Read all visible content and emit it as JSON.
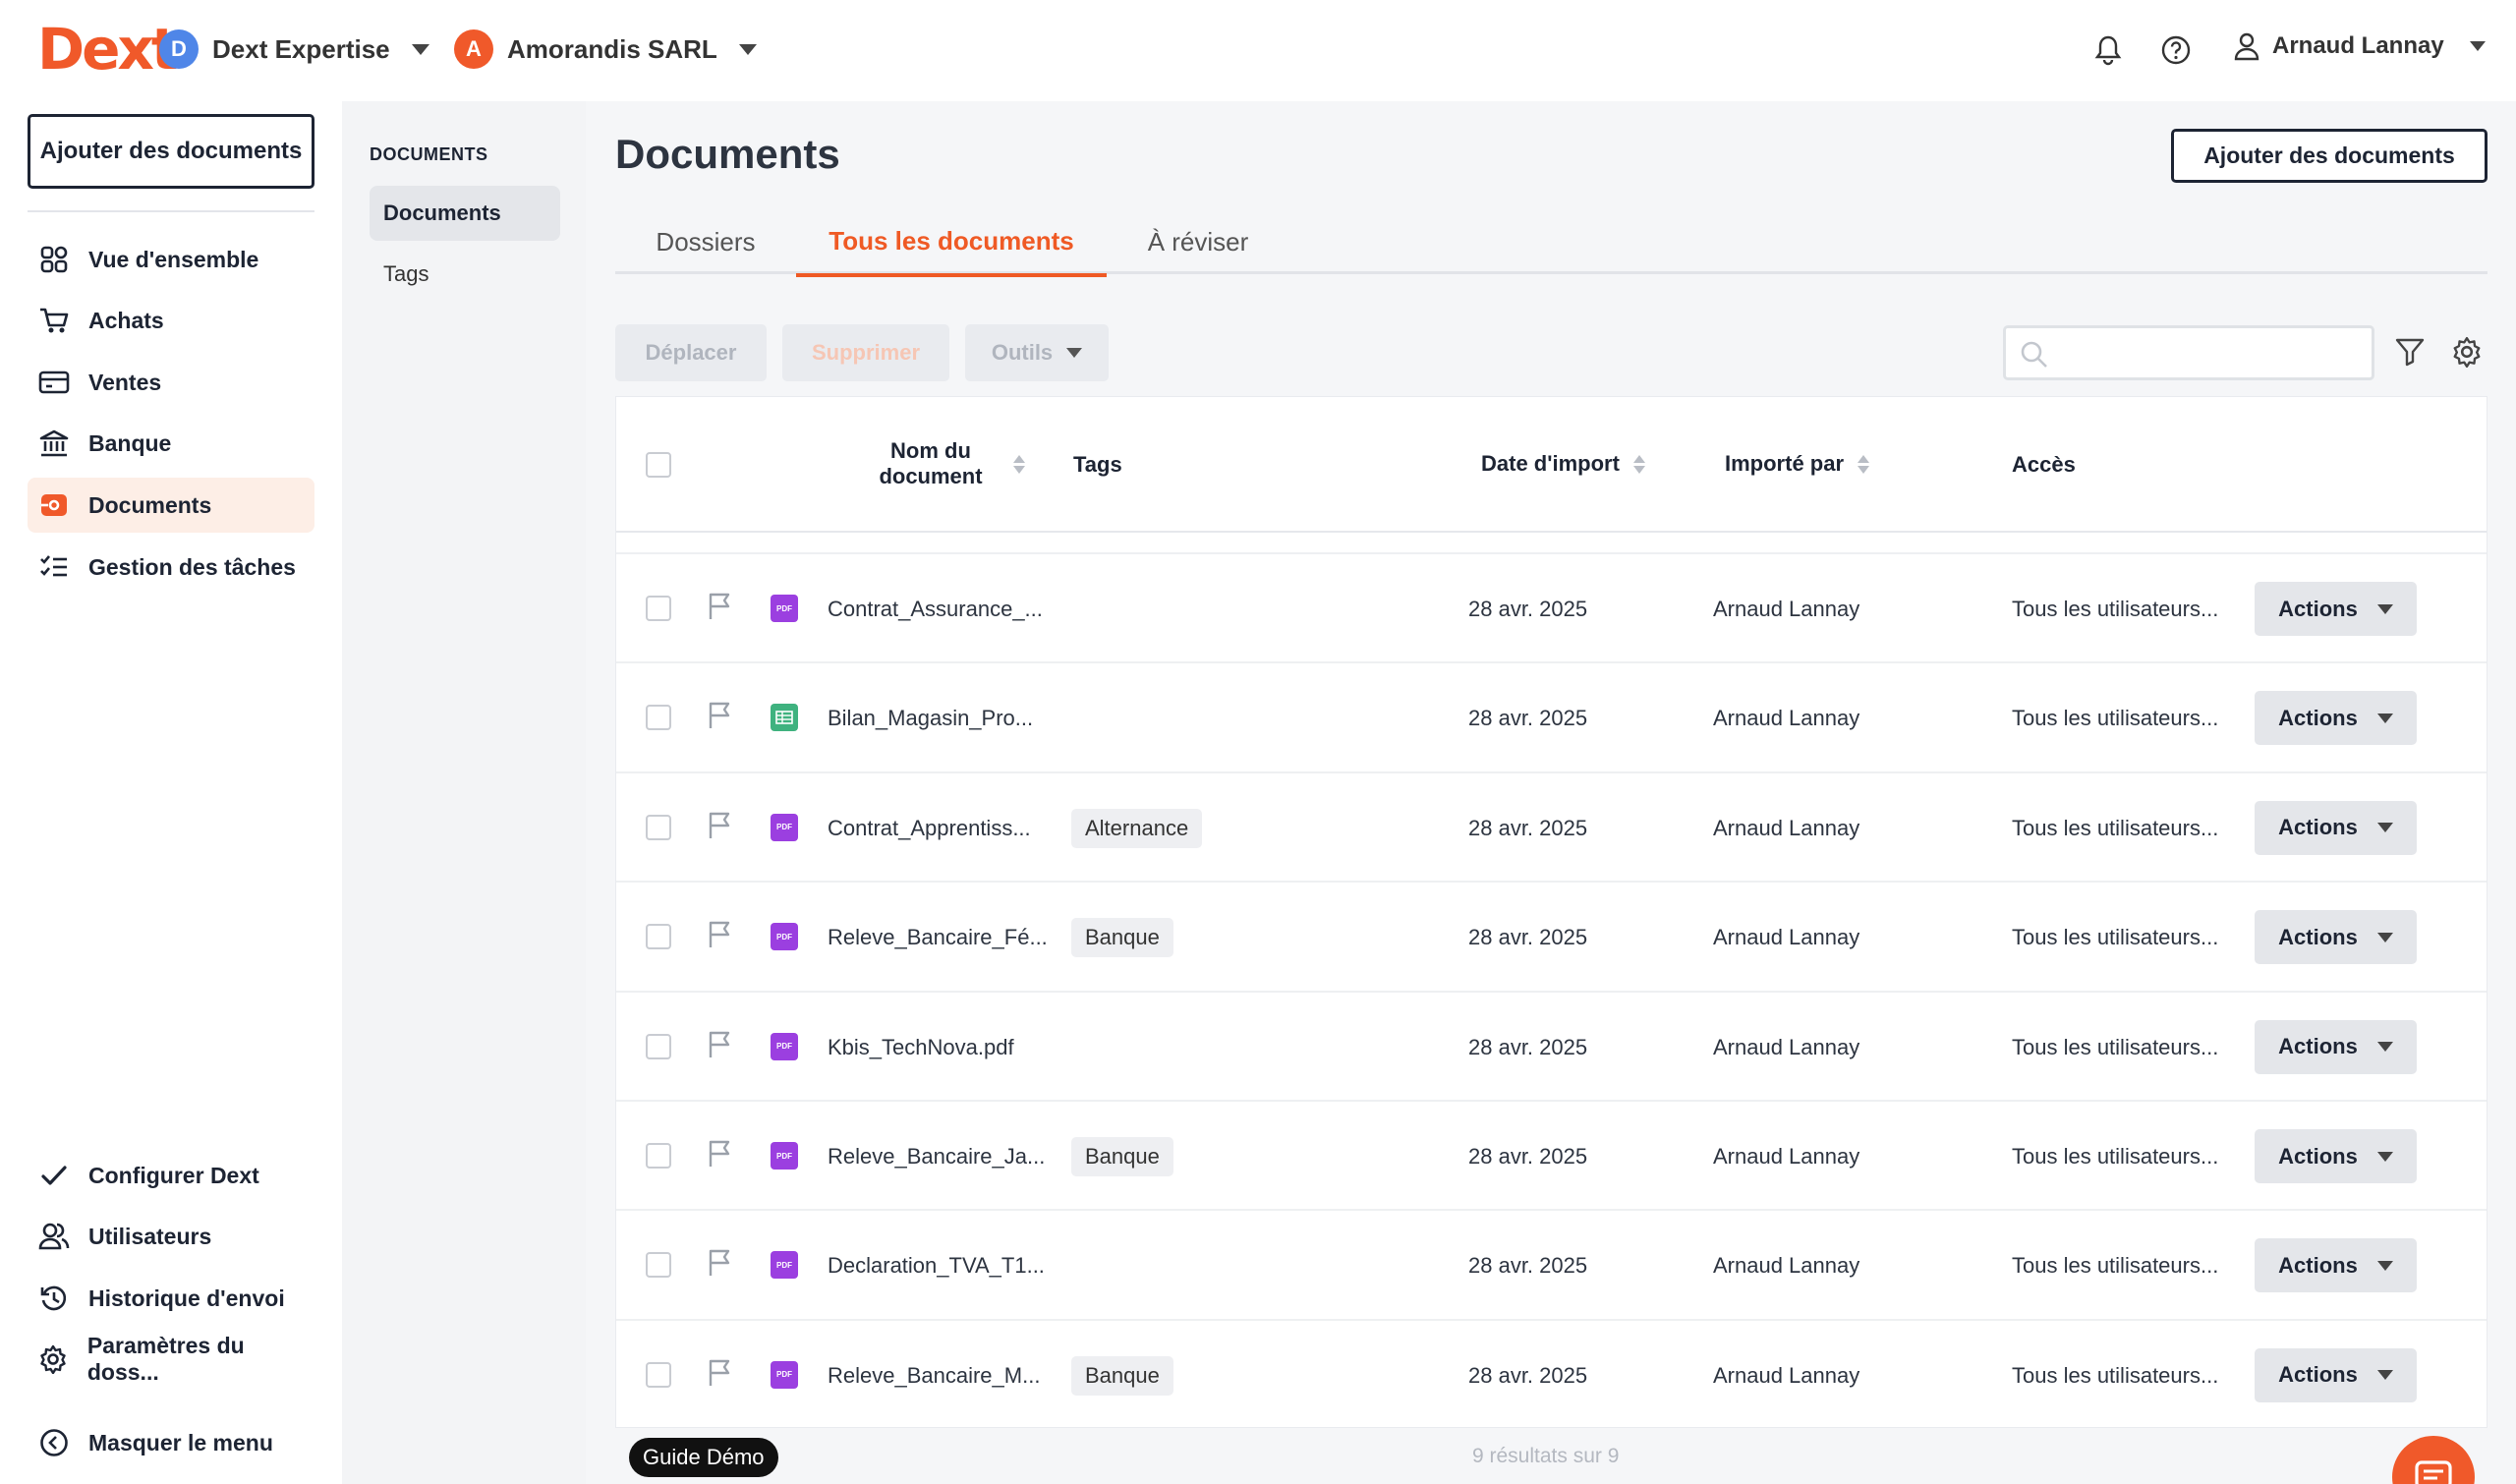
{
  "app": {
    "logo": "Dext"
  },
  "header": {
    "workspace": {
      "initial": "D",
      "name": "Dext Expertise",
      "color": "#4f86e8"
    },
    "client": {
      "initial": "A",
      "name": "Amorandis SARL",
      "color": "#f0592a"
    },
    "user": {
      "name": "Arnaud Lannay"
    }
  },
  "sidebar": {
    "add_button": "Ajouter des documents",
    "items": [
      {
        "label": "Vue d'ensemble",
        "icon": "dashboard-icon"
      },
      {
        "label": "Achats",
        "icon": "cart-icon"
      },
      {
        "label": "Ventes",
        "icon": "card-icon"
      },
      {
        "label": "Banque",
        "icon": "bank-icon"
      },
      {
        "label": "Documents",
        "icon": "documents-icon",
        "active": true
      },
      {
        "label": "Gestion des tâches",
        "icon": "tasks-icon"
      }
    ],
    "bottom_items": [
      {
        "label": "Configurer Dext",
        "icon": "check-icon"
      },
      {
        "label": "Utilisateurs",
        "icon": "users-icon"
      },
      {
        "label": "Historique d'envoi",
        "icon": "history-icon"
      },
      {
        "label": "Paramètres du doss...",
        "icon": "settings-icon"
      }
    ],
    "collapse": "Masquer le menu"
  },
  "subnav": {
    "title": "DOCUMENTS",
    "items": [
      {
        "label": "Documents",
        "active": true
      },
      {
        "label": "Tags"
      }
    ]
  },
  "main": {
    "title": "Documents",
    "add_button": "Ajouter des documents",
    "tabs": [
      {
        "label": "Dossiers"
      },
      {
        "label": "Tous les documents",
        "active": true
      },
      {
        "label": "À réviser"
      }
    ],
    "toolbar": {
      "move": "Déplacer",
      "delete": "Supprimer",
      "tools": "Outils",
      "search_placeholder": ""
    },
    "table": {
      "headers": {
        "name": "Nom du document",
        "tags": "Tags",
        "date": "Date d'import",
        "imported_by": "Importé par",
        "access": "Accès"
      },
      "rows": [
        {
          "name": "Contrat_Assurance_...",
          "type": "pdf",
          "tag": "",
          "date": "28 avr. 2025",
          "imported_by": "Arnaud Lannay",
          "access": "Tous les utilisateurs...",
          "action": "Actions"
        },
        {
          "name": "Bilan_Magasin_Pro...",
          "type": "sheet",
          "tag": "",
          "date": "28 avr. 2025",
          "imported_by": "Arnaud Lannay",
          "access": "Tous les utilisateurs...",
          "action": "Actions"
        },
        {
          "name": "Contrat_Apprentiss...",
          "type": "pdf",
          "tag": "Alternance",
          "date": "28 avr. 2025",
          "imported_by": "Arnaud Lannay",
          "access": "Tous les utilisateurs...",
          "action": "Actions"
        },
        {
          "name": "Releve_Bancaire_Fé...",
          "type": "pdf",
          "tag": "Banque",
          "date": "28 avr. 2025",
          "imported_by": "Arnaud Lannay",
          "access": "Tous les utilisateurs...",
          "action": "Actions"
        },
        {
          "name": "Kbis_TechNova.pdf",
          "type": "pdf",
          "tag": "",
          "date": "28 avr. 2025",
          "imported_by": "Arnaud Lannay",
          "access": "Tous les utilisateurs...",
          "action": "Actions"
        },
        {
          "name": "Releve_Bancaire_Ja...",
          "type": "pdf",
          "tag": "Banque",
          "date": "28 avr. 2025",
          "imported_by": "Arnaud Lannay",
          "access": "Tous les utilisateurs...",
          "action": "Actions"
        },
        {
          "name": "Declaration_TVA_T1...",
          "type": "pdf",
          "tag": "",
          "date": "28 avr. 2025",
          "imported_by": "Arnaud Lannay",
          "access": "Tous les utilisateurs...",
          "action": "Actions"
        },
        {
          "name": "Releve_Bancaire_M...",
          "type": "pdf",
          "tag": "Banque",
          "date": "28 avr. 2025",
          "imported_by": "Arnaud Lannay",
          "access": "Tous les utilisateurs...",
          "action": "Actions"
        }
      ]
    },
    "results": "9 résultats sur 9"
  },
  "guide": "Guide Démo"
}
